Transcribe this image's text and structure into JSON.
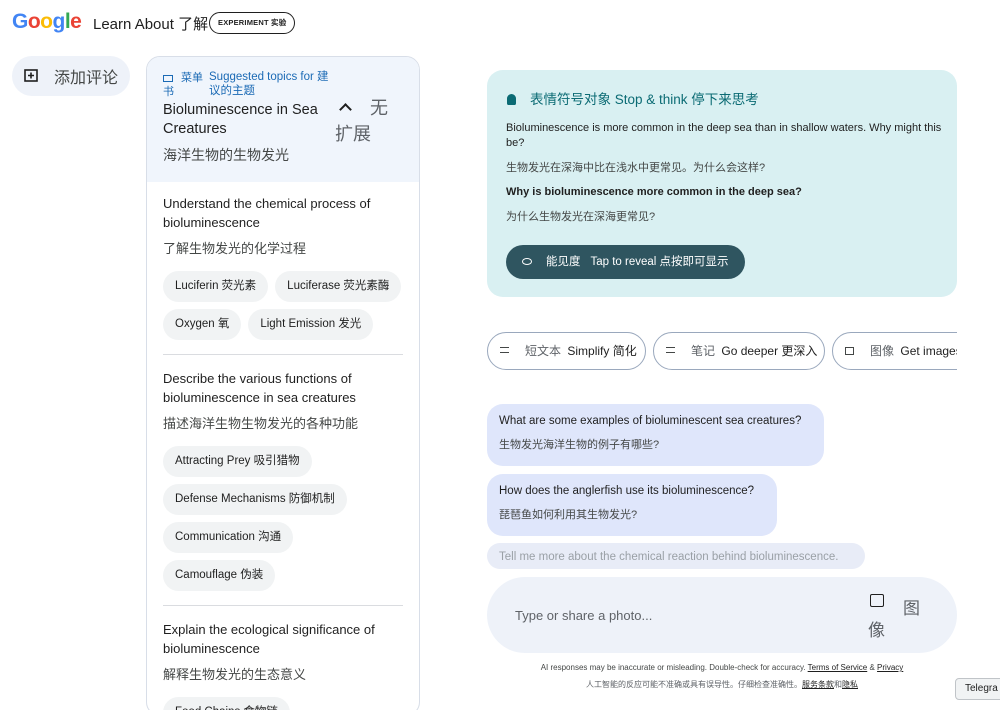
{
  "header": {
    "logo_letters": [
      {
        "ch": "G",
        "color": "#4285F4"
      },
      {
        "ch": "o",
        "color": "#EA4335"
      },
      {
        "ch": "o",
        "color": "#FBBC05"
      },
      {
        "ch": "g",
        "color": "#4285F4"
      },
      {
        "ch": "l",
        "color": "#34A853"
      },
      {
        "ch": "e",
        "color": "#EA4335"
      }
    ],
    "title": "Learn About 了解",
    "badge": "EXPERIMENT 实验"
  },
  "add_comment": {
    "label": "添加评论",
    "icon": "add-comment-icon"
  },
  "sidebar": {
    "menu_label": "菜单书",
    "suggested_label": "Suggested topics for 建议的主题",
    "topic_title": "Bioluminescence in Sea Creatures",
    "topic_title_zh": "海洋生物的生物发光",
    "collapse_label": "无扩展",
    "sections": [
      {
        "title": "Understand the chemical process of bioluminescence",
        "title_zh": "了解生物发光的化学过程",
        "chips": [
          "Luciferin 荧光素",
          "Luciferase 荧光素酶",
          "Oxygen 氧",
          "Light Emission 发光"
        ]
      },
      {
        "title": "Describe the various functions of bioluminescence in sea creatures",
        "title_zh": "描述海洋生物生物发光的各种功能",
        "chips": [
          "Attracting Prey 吸引猎物",
          "Defense Mechanisms 防御机制",
          "Communication 沟通",
          "Camouflage 伪装"
        ]
      },
      {
        "title": "Explain the ecological significance of bioluminescence",
        "title_zh": "解释生物发光的生态意义",
        "chips": [
          "Food Chains 食物链"
        ]
      }
    ]
  },
  "card": {
    "heading": "表情符号对象 Stop & think 停下来思考",
    "paragraph": "Bioluminescence is more common in the deep sea than in shallow waters. Why might this be?",
    "paragraph_zh": "生物发光在深海中比在浅水中更常见。为什么会这样?",
    "question": "Why is bioluminescence more common in the deep sea?",
    "question_zh": "为什么生物发光在深海更常见?",
    "reveal_zh": "能见度",
    "reveal_label": "Tap to reveal 点按即可显示"
  },
  "actions": [
    {
      "zh": "短文本",
      "label": "Simplify 简化",
      "icon": "short-text-icon"
    },
    {
      "zh": "笔记",
      "label": "Go deeper 更深入",
      "icon": "notes-icon"
    },
    {
      "zh": "图像",
      "label": "Get images",
      "icon": "image-icon"
    }
  ],
  "questions": [
    {
      "en": "What are some examples of bioluminescent sea creatures?",
      "zh": "生物发光海洋生物的例子有哪些?"
    },
    {
      "en": "How does the anglerfish use its bioluminescence?",
      "zh": "琵琶鱼如何利用其生物发光?"
    },
    {
      "en": "Tell me more about the chemical reaction behind bioluminescence."
    }
  ],
  "input": {
    "placeholder": "Type or share a photo...",
    "photo_label": "图像"
  },
  "disclaimer": {
    "en": "AI responses may be inaccurate or misleading. Double-check for accuracy.",
    "terms": "Terms of Service",
    "amp": "&",
    "privacy": "Privacy",
    "zh": "人工智能的反应可能不准确或具有误导性。仔细检查准确性。",
    "terms_zh": "服务条款",
    "and_zh": "和",
    "privacy_zh": "隐私"
  },
  "telegram_tab": "Telegra"
}
